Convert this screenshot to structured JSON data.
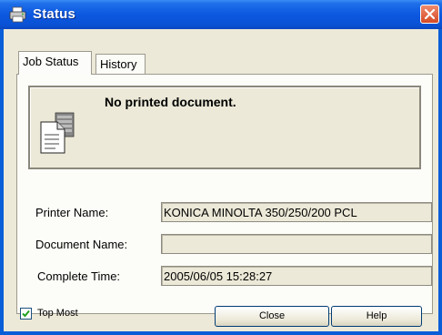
{
  "window": {
    "title": "Status"
  },
  "tabs": [
    {
      "label": "Job Status"
    },
    {
      "label": "History"
    }
  ],
  "job_status": {
    "message": "No printed document.",
    "printer_name_label": "Printer Name:",
    "printer_name_value": "KONICA MINOLTA 350/250/200 PCL",
    "document_name_label": "Document Name:",
    "document_name_value": "",
    "complete_time_label": "Complete Time:",
    "complete_time_value": "2005/06/05 15:28:27"
  },
  "footer": {
    "top_most_label": "Top Most",
    "top_most_checked": true,
    "close_label": "Close",
    "help_label": "Help"
  },
  "icons": {
    "title": "printer-icon",
    "close": "close-icon",
    "message": "document-printer-icon"
  },
  "colors": {
    "titlebar": "#0a52d6",
    "close_button": "#d44a25",
    "face": "#ece9d8"
  }
}
